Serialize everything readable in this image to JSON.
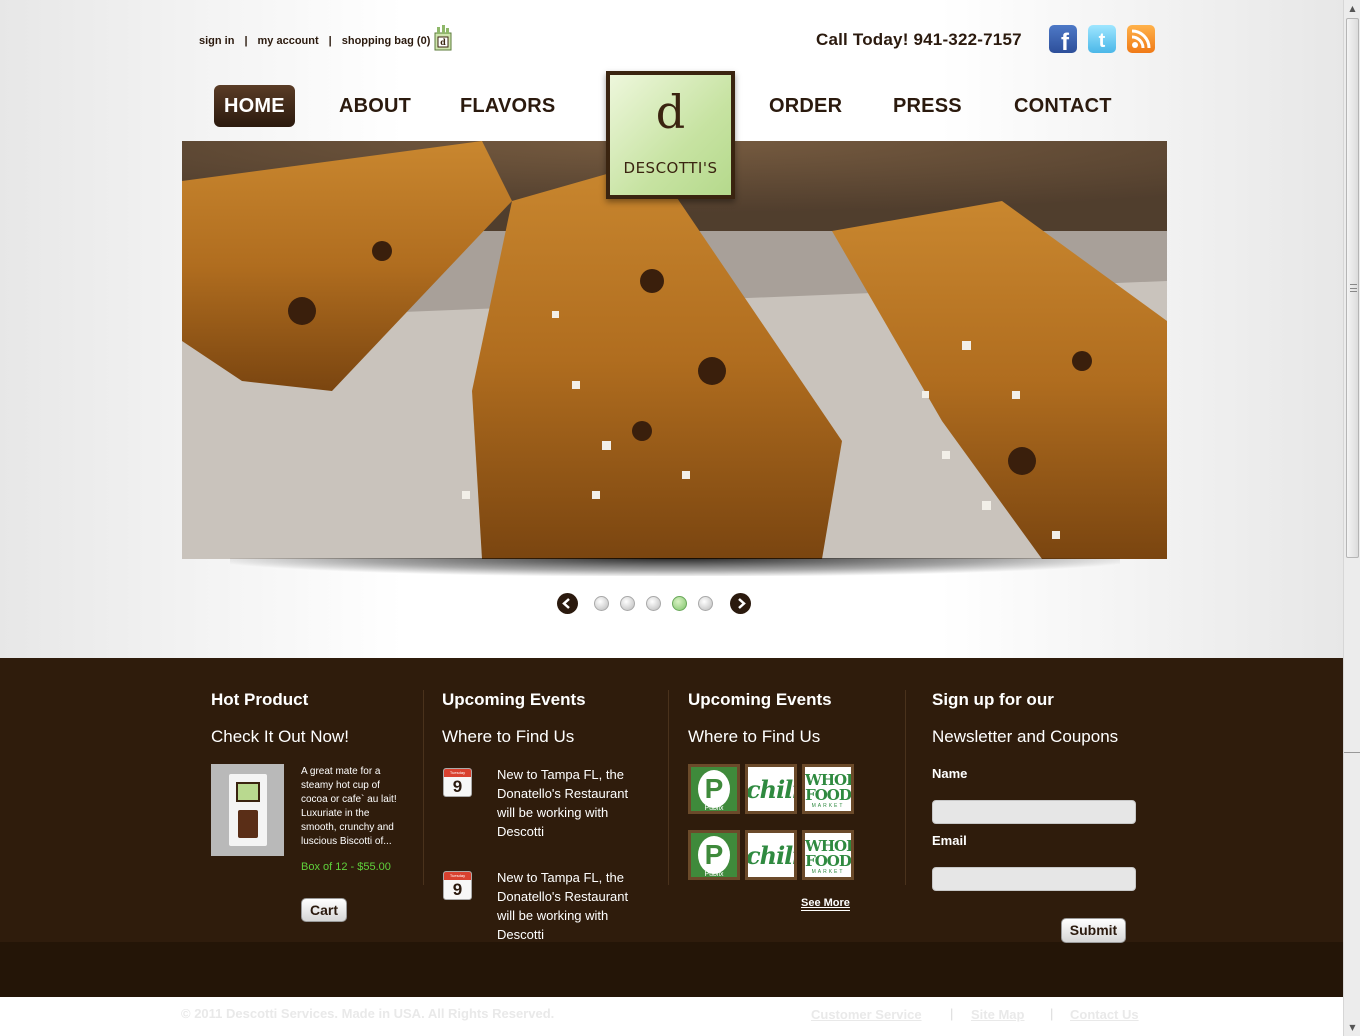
{
  "utility": {
    "sign_in": "sign in",
    "sep": "|",
    "my_account": "my account",
    "shopping_bag": "shopping bag (0)"
  },
  "header": {
    "call": "Call Today! 941-322-7157"
  },
  "nav": {
    "home": "HOME",
    "about": "ABOUT",
    "flavors": "FLAVORS",
    "order": "ORDER",
    "press": "PRESS",
    "contact": "CONTACT"
  },
  "logo": {
    "letter": "d",
    "name": "DESCOTTI'S"
  },
  "slider": {
    "prev": "‹",
    "next": "›",
    "slide_count": 5,
    "active_slide": 4
  },
  "hot_product": {
    "title": "Hot Product",
    "subtitle": "Check It Out Now!",
    "description": "A great mate for a steamy hot cup of cocoa or cafe` au lait! Luxuriate in the smooth, crunchy and luscious Biscotti of...",
    "price": "Box of 12 - $55.00",
    "cart": "Cart"
  },
  "events": {
    "title": "Upcoming Events",
    "subtitle": "Where to Find Us",
    "items": [
      {
        "cal_day": "9",
        "cal_header": "Tuesday",
        "text": "New to Tampa FL, the Donatello's Restaurant will be working with Descotti"
      },
      {
        "cal_day": "9",
        "cal_header": "Tuesday",
        "text": "New to Tampa FL, the Donatello's Restaurant will be working with Descotti"
      }
    ]
  },
  "partners": {
    "title": "Upcoming Events",
    "subtitle": "Where to Find Us",
    "publix_letter": "P",
    "publix_word": "Publix",
    "chilis_word": "chili's",
    "whole_1": "WHOL",
    "whole_2": "FOOD",
    "whole_3": "MARKET",
    "see_more": "See More"
  },
  "newsletter": {
    "title": "Sign up for our",
    "subtitle": "Newsletter and Coupons",
    "name_label": "Name",
    "email_label": "Email",
    "submit": "Submit"
  },
  "footer": {
    "copyright": "© 2011 Descotti Services. Made in USA. All Rights Reserved.",
    "customer_service": "Customer Service",
    "site_map": "Site Map",
    "contact_us": "Contact Us",
    "sep": "|"
  },
  "colors": {
    "brand_brown": "#2f1c0c",
    "accent_green": "#5fd13c"
  }
}
